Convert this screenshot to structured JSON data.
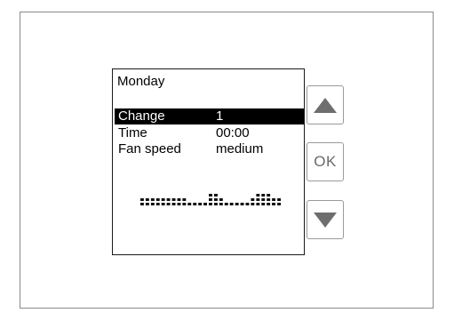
{
  "screen": {
    "day": "Monday",
    "rows": [
      {
        "label": "Change",
        "value": "1",
        "selected": true
      },
      {
        "label": "Time",
        "value": "00:00",
        "selected": false
      },
      {
        "label": "Fan  speed",
        "value": "medium",
        "selected": false
      }
    ],
    "fan_profile_levels": [
      1,
      1,
      1,
      1,
      1,
      1,
      1,
      1,
      1,
      0,
      0,
      0,
      0,
      2,
      2,
      1,
      0,
      0,
      0,
      0,
      0,
      1,
      2,
      2,
      2,
      1,
      1
    ]
  },
  "buttons": {
    "up_icon": "up-triangle-icon",
    "ok_label": "OK",
    "down_icon": "down-triangle-icon"
  },
  "colors": {
    "frame_border": "#8a8a8a",
    "screen_border": "#1a1a1a",
    "selection_bg": "#000000",
    "selection_fg": "#ffffff",
    "button_icon": "#6e6e6e"
  }
}
